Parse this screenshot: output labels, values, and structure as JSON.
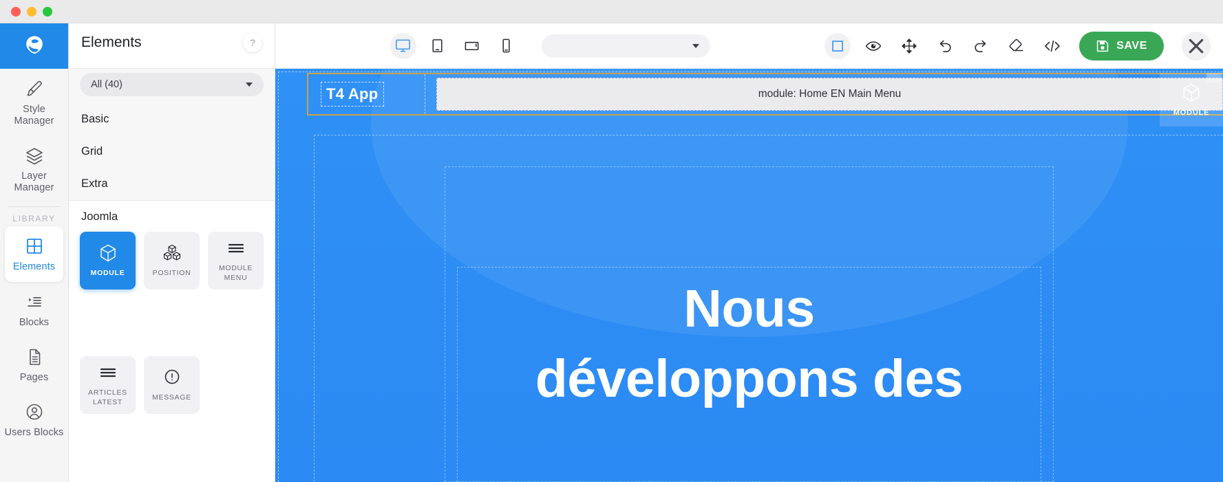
{
  "window": {
    "traffic_lights": [
      "close",
      "minimize",
      "zoom"
    ]
  },
  "rail": {
    "library_label": "LIBRARY",
    "items": [
      {
        "id": "style-manager",
        "label": "Style Manager",
        "icon": "brush-icon",
        "active": false
      },
      {
        "id": "layer-manager",
        "label": "Layer Manager",
        "icon": "layers-icon",
        "active": false
      },
      {
        "id": "elements",
        "label": "Elements",
        "icon": "grid-squares-icon",
        "active": true
      },
      {
        "id": "blocks",
        "label": "Blocks",
        "icon": "blocks-list-icon",
        "active": false
      },
      {
        "id": "pages",
        "label": "Pages",
        "icon": "page-document-icon",
        "active": false
      },
      {
        "id": "users-blocks",
        "label": "Users Blocks",
        "icon": "user-circle-icon",
        "active": false
      }
    ]
  },
  "panel": {
    "title": "Elements",
    "help_label": "?",
    "filter_value": "All (40)",
    "categories": [
      {
        "label": "Basic"
      },
      {
        "label": "Grid"
      },
      {
        "label": "Extra"
      }
    ],
    "group_title": "Joomla",
    "tiles": [
      {
        "label": "MODULE",
        "icon": "cube-icon",
        "active": true
      },
      {
        "label": "POSITION",
        "icon": "cubes-stack-icon",
        "active": false
      },
      {
        "label": "MODULE MENU",
        "icon": "hamburger-icon",
        "active": false
      },
      {
        "label": "ARTICLES LATEST",
        "icon": "hamburger-icon",
        "active": false
      },
      {
        "label": "MESSAGE",
        "icon": "alert-circle-icon",
        "active": false
      }
    ]
  },
  "toolbar": {
    "devices": [
      {
        "id": "desktop",
        "icon": "desktop-monitor-icon",
        "active": true
      },
      {
        "id": "tablet-portrait",
        "icon": "tablet-portrait-icon",
        "active": false
      },
      {
        "id": "tablet-landscape",
        "icon": "tablet-landscape-icon",
        "active": false
      },
      {
        "id": "mobile",
        "icon": "mobile-phone-icon",
        "active": false
      }
    ],
    "select_value": "",
    "actions": [
      {
        "id": "outline",
        "icon": "square-outline-icon",
        "active": true
      },
      {
        "id": "preview",
        "icon": "eye-icon",
        "active": false
      },
      {
        "id": "move",
        "icon": "move-arrows-icon",
        "active": false
      },
      {
        "id": "undo",
        "icon": "undo-icon",
        "active": false
      },
      {
        "id": "redo",
        "icon": "redo-icon",
        "active": false
      },
      {
        "id": "clear",
        "icon": "eraser-icon",
        "active": false
      },
      {
        "id": "code",
        "icon": "code-brackets-icon",
        "active": false
      }
    ],
    "save_label": "SAVE",
    "close_label": "✕"
  },
  "canvas": {
    "logo_text": "T4 App",
    "module_placeholder": "module: Home EN Main Menu",
    "drag_badge_label": "MODULE",
    "hero_line1": "Nous",
    "hero_line2": "développons des"
  },
  "colors": {
    "brand_blue": "#2189e8",
    "canvas_blue": "#2f90f5",
    "save_green": "#3aa757",
    "selection_gold": "#c9a24a",
    "tile_grey": "#f1f1f3"
  }
}
